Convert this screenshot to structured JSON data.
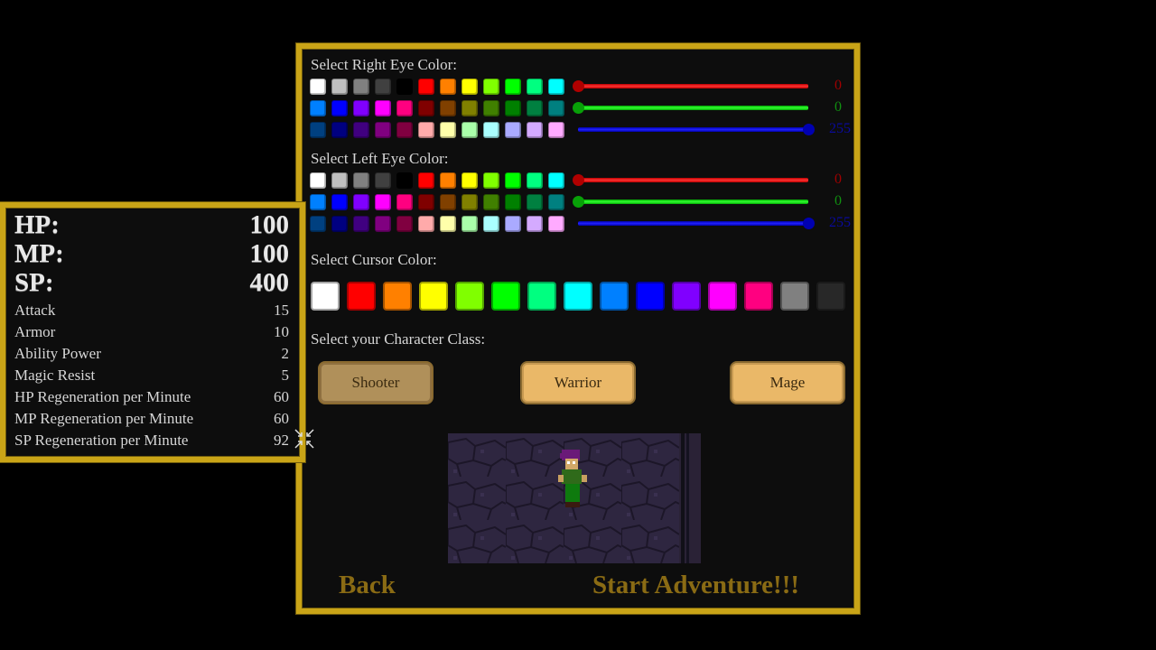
{
  "right_eye": {
    "label": "Select Right Eye Color:",
    "palette": [
      "#ffffff",
      "#bfbfbf",
      "#808080",
      "#404040",
      "#000000",
      "#ff0000",
      "#ff8000",
      "#ffff00",
      "#80ff00",
      "#00ff00",
      "#00ff80",
      "#00ffff",
      "#0080ff",
      "#0000ff",
      "#8000ff",
      "#ff00ff",
      "#ff0080",
      "#800000",
      "#804000",
      "#808000",
      "#408000",
      "#008000",
      "#008040",
      "#008080",
      "#004080",
      "#000080",
      "#400080",
      "#800080",
      "#800040",
      "#ffaaaa",
      "#ffffaa",
      "#aaffaa",
      "#aaffff",
      "#aaaaff",
      "#d4aaff",
      "#ffaaff"
    ],
    "rgb": {
      "r": 0,
      "g": 0,
      "b": 255
    },
    "r_label": "0",
    "g_label": "0",
    "b_label": "255"
  },
  "left_eye": {
    "label": "Select Left Eye Color:",
    "palette": [
      "#ffffff",
      "#bfbfbf",
      "#808080",
      "#404040",
      "#000000",
      "#ff0000",
      "#ff8000",
      "#ffff00",
      "#80ff00",
      "#00ff00",
      "#00ff80",
      "#00ffff",
      "#0080ff",
      "#0000ff",
      "#8000ff",
      "#ff00ff",
      "#ff0080",
      "#800000",
      "#804000",
      "#808000",
      "#408000",
      "#008000",
      "#008040",
      "#008080",
      "#004080",
      "#000080",
      "#400080",
      "#800080",
      "#800040",
      "#ffaaaa",
      "#ffffaa",
      "#aaffaa",
      "#aaffff",
      "#aaaaff",
      "#d4aaff",
      "#ffaaff"
    ],
    "rgb": {
      "r": 0,
      "g": 0,
      "b": 255
    },
    "r_label": "0",
    "g_label": "0",
    "b_label": "255"
  },
  "cursor": {
    "label": "Select Cursor Color:",
    "palette": [
      "#ffffff",
      "#ff0000",
      "#ff8000",
      "#ffff00",
      "#80ff00",
      "#00ff00",
      "#00ff80",
      "#00ffff",
      "#0080ff",
      "#0000ff",
      "#8000ff",
      "#ff00ff",
      "#ff0080",
      "#808080",
      "#282828"
    ]
  },
  "character_class": {
    "label": "Select your Character Class:",
    "options": [
      "Shooter",
      "Warrior",
      "Mage"
    ],
    "selected": "Shooter"
  },
  "nav": {
    "back": "Back",
    "start": "Start Adventure!!!"
  },
  "stats": {
    "primary": [
      {
        "label": "HP:",
        "value": "100"
      },
      {
        "label": "MP:",
        "value": "100"
      },
      {
        "label": "SP:",
        "value": "400"
      }
    ],
    "secondary": [
      {
        "label": "Attack",
        "value": "15"
      },
      {
        "label": "Armor",
        "value": "10"
      },
      {
        "label": "Ability Power",
        "value": "2"
      },
      {
        "label": "Magic Resist",
        "value": "5"
      },
      {
        "label": "HP Regeneration per Minute",
        "value": "60"
      },
      {
        "label": "MP Regeneration per Minute",
        "value": "60"
      },
      {
        "label": "SP Regeneration per Minute",
        "value": "92"
      }
    ]
  },
  "colors": {
    "frame": "#c9a417",
    "nav_text": "#8a6b14",
    "button": "#eab868",
    "button_selected": "#b0905a"
  }
}
